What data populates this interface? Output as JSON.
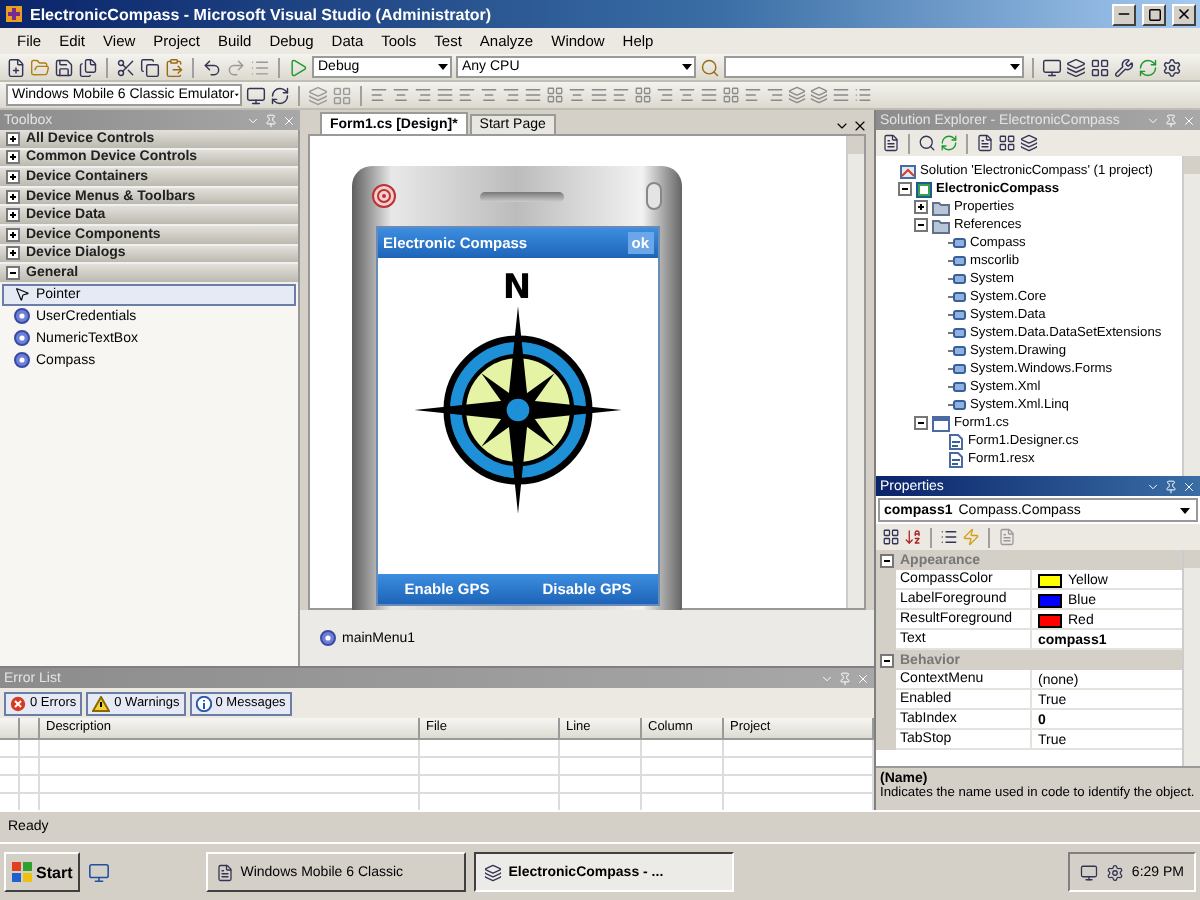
{
  "window": {
    "title": "ElectronicCompass - Microsoft Visual Studio (Administrator)"
  },
  "menu": [
    "File",
    "Edit",
    "View",
    "Project",
    "Build",
    "Debug",
    "Data",
    "Tools",
    "Test",
    "Analyze",
    "Window",
    "Help"
  ],
  "toolbar": {
    "configuration": "Debug",
    "platform": "Any CPU",
    "device": "Windows Mobile 6 Classic Emulator"
  },
  "toolbox": {
    "title": "Toolbox",
    "active": false,
    "categories": [
      {
        "label": "All Device Controls",
        "expanded": false
      },
      {
        "label": "Common Device Controls",
        "expanded": false
      },
      {
        "label": "Device Containers",
        "expanded": false
      },
      {
        "label": "Device Menus & Toolbars",
        "expanded": false
      },
      {
        "label": "Device Data",
        "expanded": false
      },
      {
        "label": "Device Components",
        "expanded": false
      },
      {
        "label": "Device Dialogs",
        "expanded": false
      },
      {
        "label": "General",
        "expanded": true
      }
    ],
    "items": [
      {
        "label": "Pointer",
        "kind": "pointer",
        "selected": true
      },
      {
        "label": "UserCredentials",
        "kind": "component",
        "selected": false
      },
      {
        "label": "NumericTextBox",
        "kind": "component",
        "selected": false
      },
      {
        "label": "Compass",
        "kind": "component",
        "selected": false
      }
    ]
  },
  "designer": {
    "tabs": [
      {
        "label": "Form1.cs [Design]*",
        "selected": true
      },
      {
        "label": "Start Page",
        "selected": false
      }
    ],
    "form": {
      "title": "Electronic Compass",
      "ok": "ok",
      "compass_letter": "N",
      "menu": [
        "Enable GPS",
        "Disable GPS"
      ]
    },
    "tray": [
      "mainMenu1"
    ]
  },
  "error_list": {
    "title": "Error List",
    "active": false,
    "filters": [
      {
        "label": "0 Errors",
        "kind": "error",
        "on": true
      },
      {
        "label": "0 Warnings",
        "kind": "warning",
        "on": true
      },
      {
        "label": "0 Messages",
        "kind": "message",
        "on": true
      }
    ],
    "columns": [
      "Description",
      "File",
      "Line",
      "Column",
      "Project"
    ]
  },
  "solution_explorer": {
    "title": "Solution Explorer - ElectronicCompass",
    "active": false,
    "tree": [
      {
        "label": "Solution 'ElectronicCompass' (1 project)",
        "kind": "solution",
        "children": [
          {
            "label": "ElectronicCompass",
            "kind": "project",
            "expanded": true,
            "children": [
              {
                "label": "Properties",
                "kind": "folder",
                "expanded": false
              },
              {
                "label": "References",
                "kind": "folder",
                "expanded": true,
                "children": [
                  {
                    "label": "Compass",
                    "kind": "reference"
                  },
                  {
                    "label": "mscorlib",
                    "kind": "reference"
                  },
                  {
                    "label": "System",
                    "kind": "reference"
                  },
                  {
                    "label": "System.Core",
                    "kind": "reference"
                  },
                  {
                    "label": "System.Data",
                    "kind": "reference"
                  },
                  {
                    "label": "System.Data.DataSetExtensions",
                    "kind": "reference"
                  },
                  {
                    "label": "System.Drawing",
                    "kind": "reference"
                  },
                  {
                    "label": "System.Windows.Forms",
                    "kind": "reference"
                  },
                  {
                    "label": "System.Xml",
                    "kind": "reference"
                  },
                  {
                    "label": "System.Xml.Linq",
                    "kind": "reference"
                  }
                ]
              },
              {
                "label": "Form1.cs",
                "kind": "form",
                "expanded": true,
                "children": [
                  {
                    "label": "Form1.Designer.cs",
                    "kind": "code"
                  },
                  {
                    "label": "Form1.resx",
                    "kind": "code"
                  }
                ]
              }
            ]
          }
        ]
      }
    ]
  },
  "properties": {
    "title": "Properties",
    "active": true,
    "object_name": "compass1",
    "object_type": "Compass.Compass",
    "rows": [
      {
        "kind": "category",
        "label": "Appearance",
        "expanded": true
      },
      {
        "kind": "property",
        "label": "CompassColor",
        "value": "Yellow",
        "color": "#ffff00",
        "modified": false
      },
      {
        "kind": "property",
        "label": "LabelForeground",
        "value": "Blue",
        "color": "#0000ff",
        "modified": false
      },
      {
        "kind": "property",
        "label": "ResultForeground",
        "value": "Red",
        "color": "#ff0000",
        "modified": false
      },
      {
        "kind": "property",
        "label": "Text",
        "value": "compass1",
        "modified": true
      },
      {
        "kind": "category",
        "label": "Behavior",
        "expanded": true
      },
      {
        "kind": "property",
        "label": "ContextMenu",
        "value": "(none)",
        "modified": false
      },
      {
        "kind": "property",
        "label": "Enabled",
        "value": "True",
        "modified": false
      },
      {
        "kind": "property",
        "label": "TabIndex",
        "value": "0",
        "modified": true
      },
      {
        "kind": "property",
        "label": "TabStop",
        "value": "True",
        "modified": false
      }
    ],
    "description": {
      "name": "(Name)",
      "text": "Indicates the name used in code to identify the object."
    }
  },
  "status_bar": {
    "text": "Ready"
  },
  "taskbar": {
    "start": "Start",
    "buttons": [
      {
        "label": "Windows Mobile 6 Classic",
        "selected": false
      },
      {
        "label": "ElectronicCompass - ...",
        "selected": true
      }
    ],
    "clock": "6:29 PM"
  }
}
